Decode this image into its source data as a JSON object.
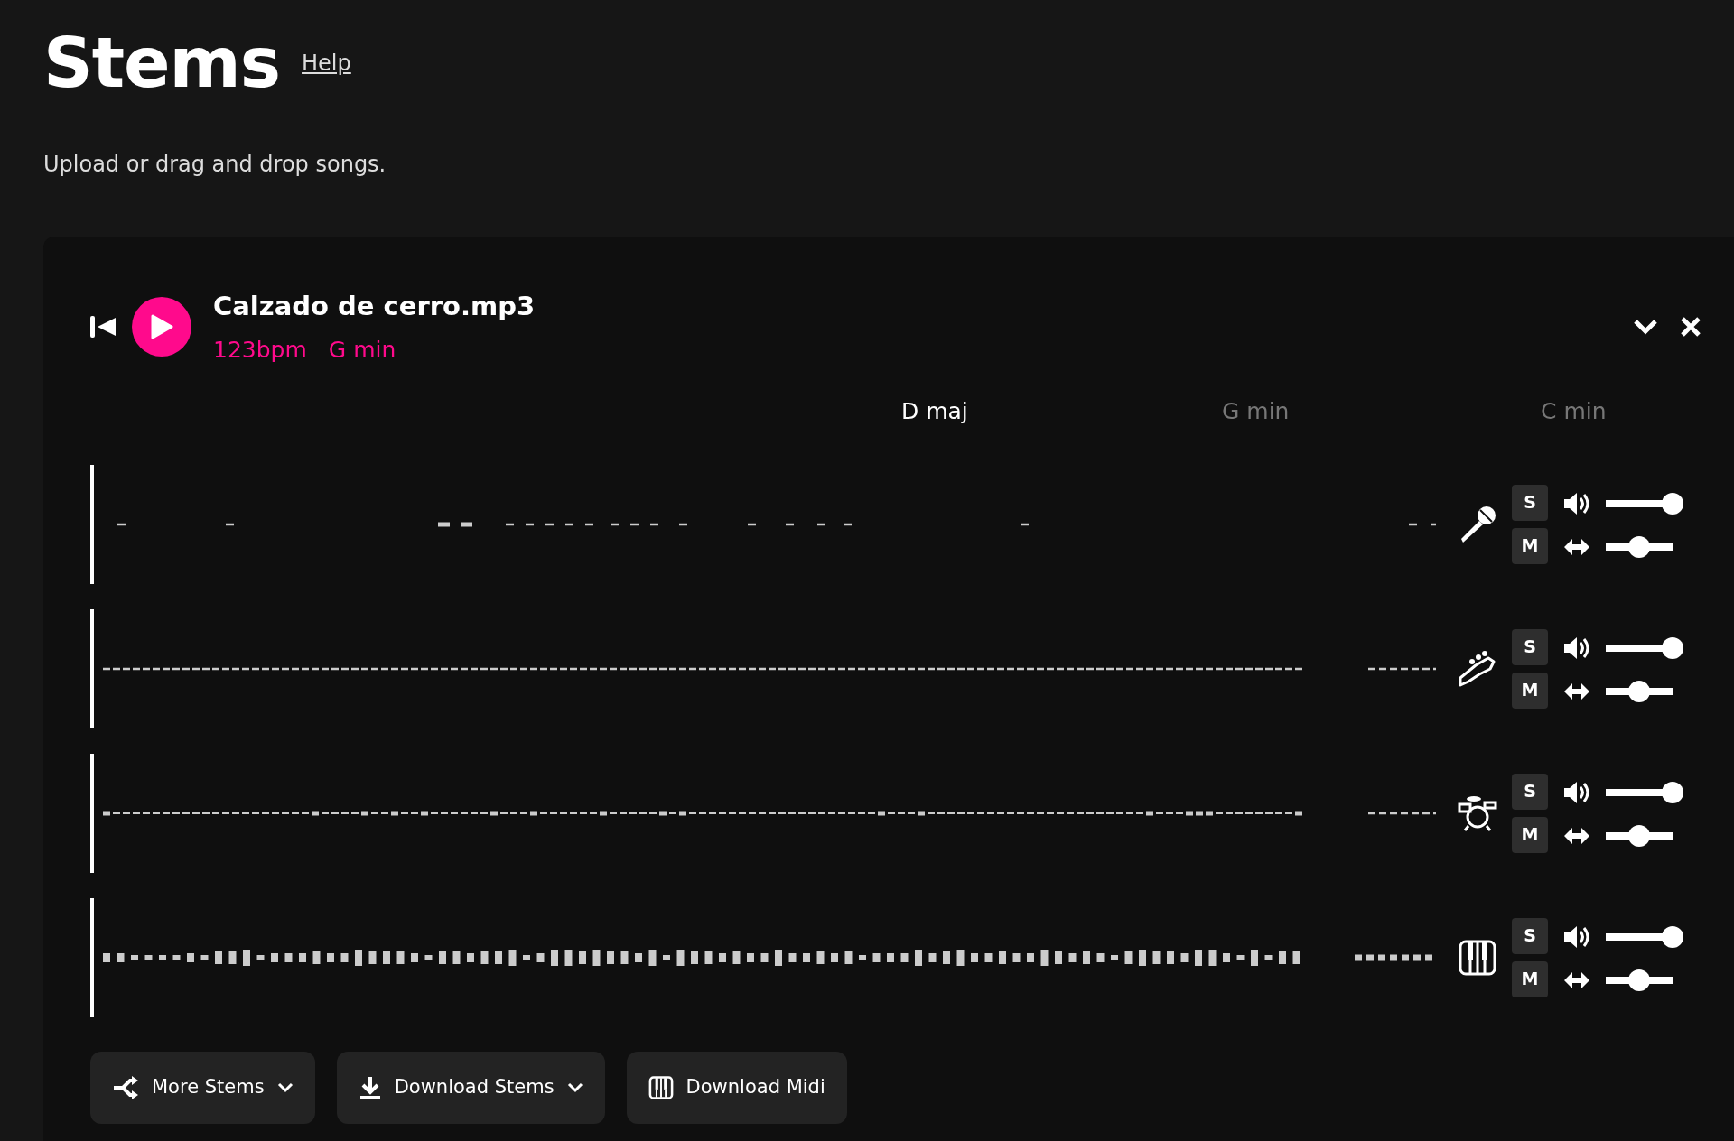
{
  "page": {
    "title": "Stems",
    "help_link": "Help",
    "subtitle": "Upload or drag and drop songs."
  },
  "song": {
    "title": "Calzado de cerro.mp3",
    "bpm": "123bpm",
    "key": "G min",
    "chords": [
      {
        "label": "D maj",
        "active": true
      },
      {
        "label": "G min",
        "active": false
      },
      {
        "label": "C min",
        "active": false
      }
    ],
    "tracks": [
      {
        "kind": "vocals",
        "solo": {
          "label": "S",
          "on": false
        },
        "mute": {
          "label": "M",
          "on": false
        },
        "volume": {
          "level": 1
        },
        "pan": {
          "level": 0.5
        }
      },
      {
        "kind": "bass",
        "solo": {
          "label": "S",
          "on": false
        },
        "mute": {
          "label": "M",
          "on": false
        },
        "volume": {
          "level": 1
        },
        "pan": {
          "level": 0.5
        }
      },
      {
        "kind": "drums",
        "solo": {
          "label": "S",
          "on": false
        },
        "mute": {
          "label": "M",
          "on": false
        },
        "volume": {
          "level": 1
        },
        "pan": {
          "level": 0.5
        }
      },
      {
        "kind": "piano",
        "solo": {
          "label": "S",
          "on": false
        },
        "mute": {
          "label": "M",
          "on": false
        },
        "volume": {
          "level": 1
        },
        "pan": {
          "level": 0.5
        }
      }
    ],
    "actions": [
      {
        "label": "More Stems",
        "kind": "split",
        "dropdown": true
      },
      {
        "label": "Download Stems",
        "kind": "download",
        "dropdown": true
      },
      {
        "label": "Download Midi",
        "kind": "midi",
        "dropdown": false
      }
    ]
  }
}
